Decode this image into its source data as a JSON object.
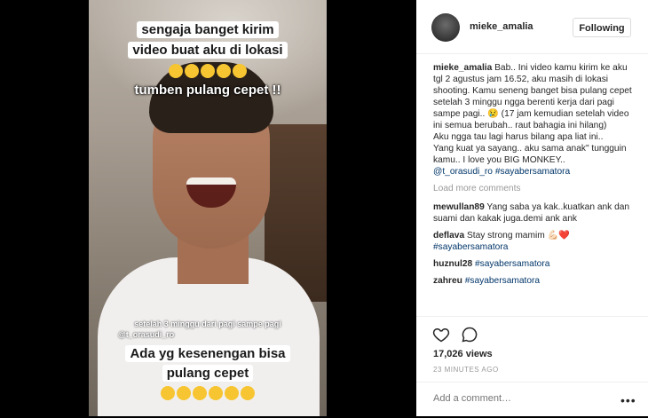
{
  "media": {
    "caption_top_line1": "sengaja banget kirim",
    "caption_top_line2": "video buat aku di lokasi",
    "caption_middle": "tumben pulang cepet !!",
    "caption_small": "setelah 3 minggu dari pagi sampe pagi",
    "caption_mention": "@t_orasudi_ro",
    "caption_bottom_line1": "Ada yg kesenengan bisa",
    "caption_bottom_line2": "pulang cepet",
    "emoji_name": "laughing-crying-emoji"
  },
  "header": {
    "username": "mieke_amalia",
    "follow_label": "Following"
  },
  "caption": {
    "username": "mieke_amalia",
    "text": "Bab.. Ini video kamu kirim ke aku tgl 2 agustus jam 16.52, aku masih di lokasi shooting. Kamu seneng banget bisa pulang cepet setelah 3 minggu ngga berenti kerja dari pagi sampe pagi.. 😢 (17 jam kemudian setelah video ini semua berubah.. raut bahagia ini hilang)",
    "line2": "Aku ngga tau lagi harus bilang apa liat ini..",
    "line3": "Yang kuat ya sayang.. aku sama anak\" tungguin kamu.. I love you BIG MONKEY..",
    "mention": "@t_orasudi_ro",
    "hashtag": "#sayabersamatora"
  },
  "load_more": "Load more comments",
  "comments": [
    {
      "user": "mewullan89",
      "text": "Yang saba ya kak..kuatkan ank dan suami dan kakak juga.demi ank ank",
      "tag": ""
    },
    {
      "user": "deflava",
      "text": "Stay strong mamim 💪🏻❤️",
      "tag": "#sayabersamatora"
    },
    {
      "user": "huznul28",
      "text": "",
      "tag": "#sayabersamatora"
    },
    {
      "user": "zahreu",
      "text": "",
      "tag": "#sayabersamatora"
    }
  ],
  "actions": {
    "views": "17,026 views",
    "time": "23 MINUTES AGO",
    "comment_placeholder": "Add a comment…",
    "more": "•••"
  }
}
